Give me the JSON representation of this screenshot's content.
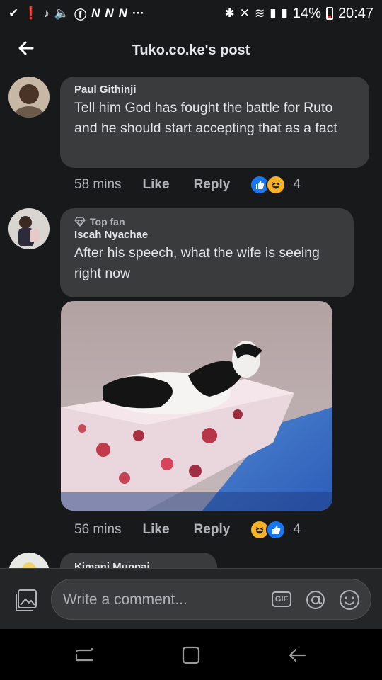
{
  "status_bar": {
    "left_icons": [
      "check-icon",
      "alert-icon",
      "tiktok-icon",
      "volume-icon",
      "facebook-icon",
      "n-icon",
      "n-icon",
      "n-icon",
      "more-dots-icon"
    ],
    "right_icons": [
      "bluetooth-icon",
      "mute-icon",
      "wifi-icon",
      "signal-icon",
      "signal-icon"
    ],
    "battery": "14%",
    "time": "20:47"
  },
  "header": {
    "title": "Tuko.co.ke's post"
  },
  "comments": [
    {
      "author": "Paul Githinji",
      "text": "Tell him God has fought the battle for Ruto and he should start accepting that as a fact",
      "time": "58 mins",
      "like_label": "Like",
      "reply_label": "Reply",
      "reaction_count": "4",
      "reactions": [
        "like",
        "haha"
      ]
    },
    {
      "badge": "Top fan",
      "author": "Iscah Nyachae",
      "text": "After his speech, what the wife is seeing right now",
      "time": "56 mins",
      "like_label": "Like",
      "reply_label": "Reply",
      "reaction_count": "4",
      "reactions": [
        "haha",
        "like"
      ]
    },
    {
      "author": "Kimani Mungai"
    }
  ],
  "composer": {
    "placeholder": "Write a comment...",
    "gif_label": "GIF"
  },
  "colors": {
    "background": "#18191a",
    "bubble": "#3a3b3c",
    "like_blue": "#1877f2",
    "haha_yellow": "#f7b125"
  }
}
